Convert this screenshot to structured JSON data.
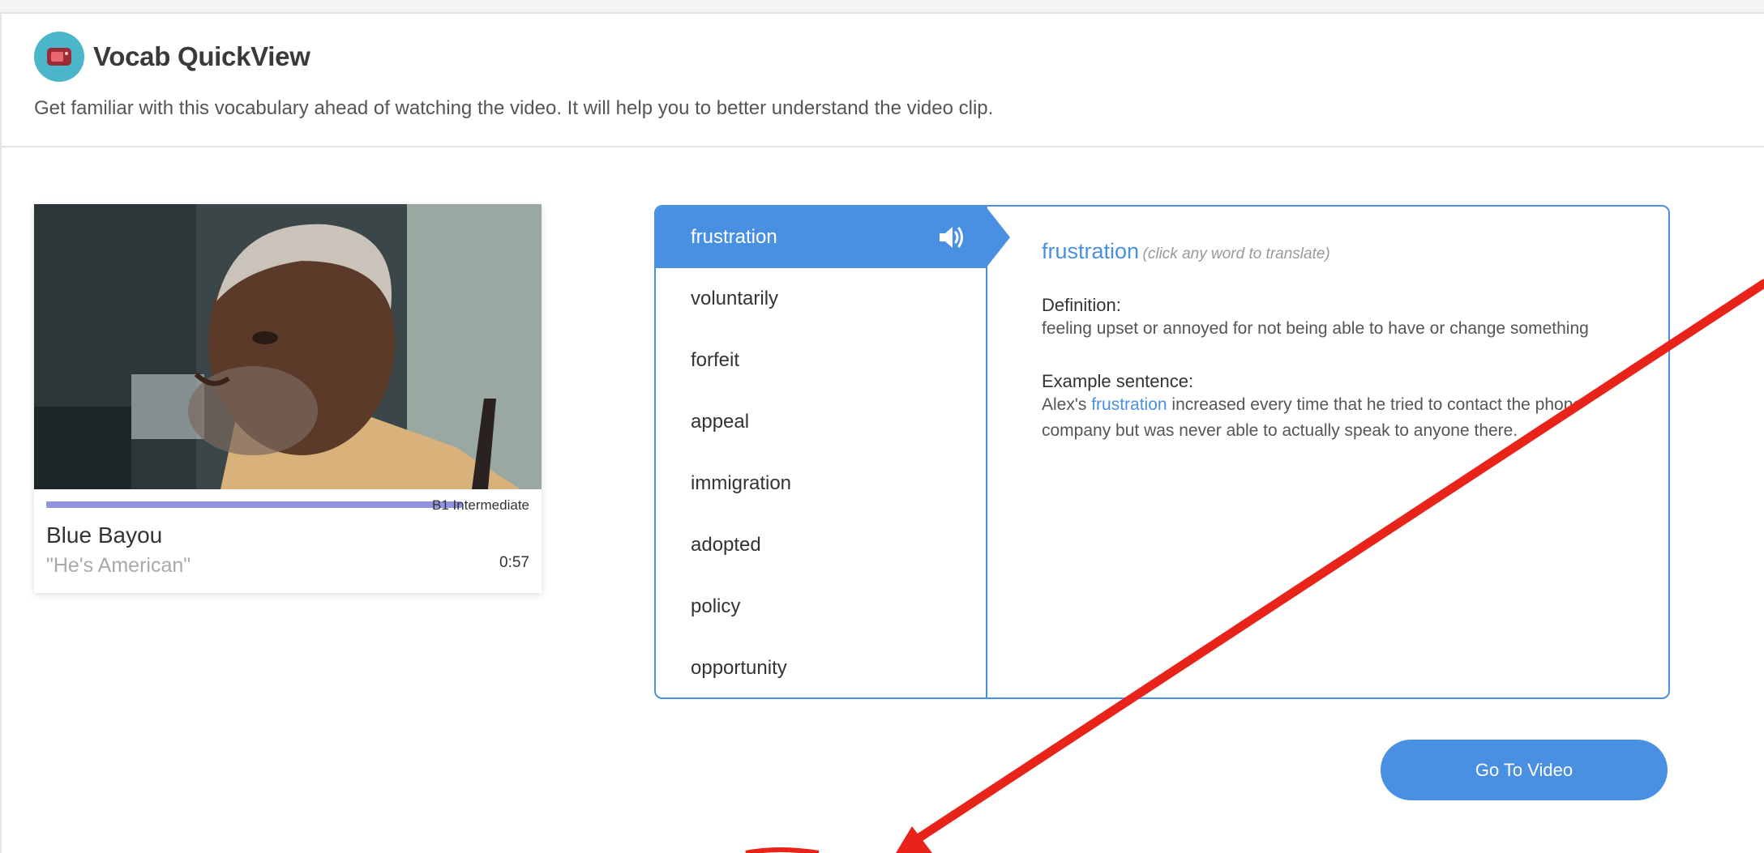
{
  "header": {
    "title": "Vocab QuickView",
    "subtitle": "Get familiar with this vocabulary ahead of watching the video. It will help you to better understand the video clip."
  },
  "video": {
    "level": "B1 Intermediate",
    "title": "Blue Bayou",
    "quote": "\"He's American\"",
    "duration": "0:57"
  },
  "vocab": {
    "words": [
      "frustration",
      "voluntarily",
      "forfeit",
      "appeal",
      "immigration",
      "adopted",
      "policy",
      "opportunity"
    ],
    "selected": {
      "word": "frustration",
      "hint": "(click any word to translate)",
      "definition_label": "Definition:",
      "definition": "feeling upset or annoyed for not being able to have or change something",
      "example_label": "Example sentence:",
      "example_before": "Alex's ",
      "example_highlight": "frustration",
      "example_after": " increased every time that he tried to contact the phone company but was never able to actually speak to anyone there."
    }
  },
  "actions": {
    "go_to_video": "Go To Video"
  },
  "colors": {
    "accent": "#4a90e2",
    "progress": "#8f93e0",
    "annotation_arrow": "#e8231a"
  },
  "icons": {
    "logo": "tv-icon",
    "audio": "speaker-icon"
  }
}
